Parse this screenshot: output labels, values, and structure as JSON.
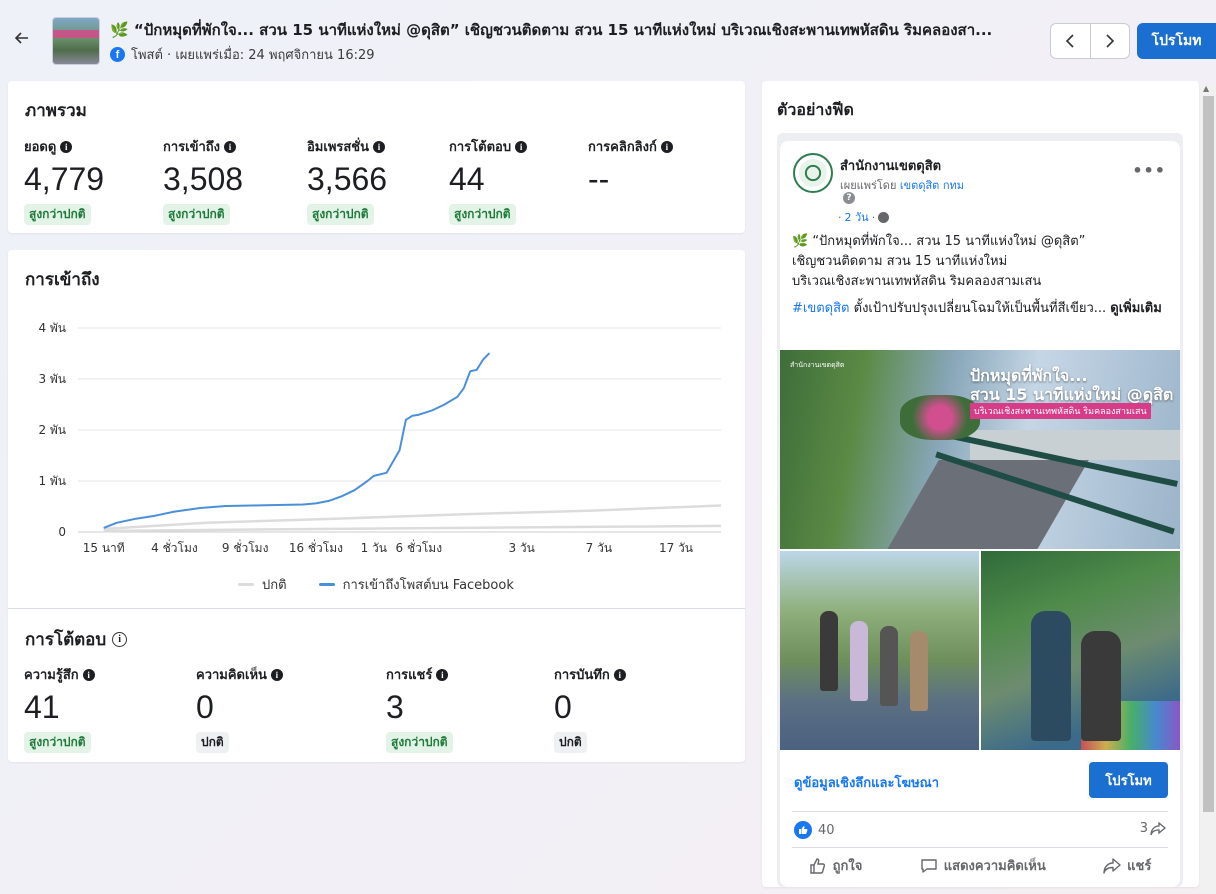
{
  "header": {
    "title": "🌿 “ปักหมุดที่พักใจ... สวน 15 นาทีแห่งใหม่ @ดุสิต” เชิญชวนติดตาม สวน 15 นาทีแห่งใหม่ บริเวณเชิงสะพานเทพหัสดิน ริมคลองสา...",
    "subtitle": "โพสต์ · เผยแพร่เมื่อ: 24 พฤศจิกายน 16:29",
    "promote_label": "โปรโมท"
  },
  "overview": {
    "title": "ภาพรวม",
    "metrics": [
      {
        "label": "ยอดดู",
        "value": "4,779",
        "badge": "สูงกว่าปกติ"
      },
      {
        "label": "การเข้าถึง",
        "value": "3,508",
        "badge": "สูงกว่าปกติ"
      },
      {
        "label": "อิมเพรสชั่น",
        "value": "3,566",
        "badge": "สูงกว่าปกติ"
      },
      {
        "label": "การโต้ตอบ",
        "value": "44",
        "badge": "สูงกว่าปกติ"
      },
      {
        "label": "การคลิกลิงก์",
        "value": "--"
      }
    ]
  },
  "reach": {
    "title": "การเข้าถึง",
    "legend_normal": "ปกติ",
    "legend_post": "การเข้าถึงโพสต์บน Facebook"
  },
  "interactions": {
    "title": "การโต้ตอบ",
    "metrics": [
      {
        "label": "ความรู้สึก",
        "value": "41",
        "badge": "สูงกว่าปกติ"
      },
      {
        "label": "ความคิดเห็น",
        "value": "0",
        "badge": "ปกติ"
      },
      {
        "label": "การแชร์",
        "value": "3",
        "badge": "สูงกว่าปกติ"
      },
      {
        "label": "การบันทึก",
        "value": "0",
        "badge": "ปกติ"
      }
    ]
  },
  "preview": {
    "title": "ตัวอย่างฟีด",
    "page_name": "สำนักงานเขตดุสิต",
    "published_prefix": "เผยแพร่โดย",
    "published_by": "เขตดุสิต กทม",
    "question_mark": "?",
    "time_prefix": "·",
    "time": "2 วัน",
    "time_suffix": "·",
    "text_line1": "🌿 “ปักหมุดที่พักใจ... สวน 15 นาทีแห่งใหม่ @ดุสิต”",
    "text_line2": "เชิญชวนติดตาม สวน 15 นาทีแห่งใหม่",
    "text_line3": "บริเวณเชิงสะพานเทพหัสดิน ริมคลองสามเสน",
    "hashtag": "#เขตดุสิต",
    "tag_text": "ตั้งเป้าปรับปรุงเปลี่ยนโฉมให้เป็นพื้นที่สีเขียว...",
    "see_more": "ดูเพิ่มเติม",
    "image_title_1": "ปักหมุดที่พักใจ...",
    "image_title_2": "สวน 15 นาทีแห่งใหม่ @ดุสิต",
    "image_band": "บริเวณเชิงสะพานเทพหัสดิน ริมคลองสามเสน",
    "image_logo": "สำนักงานเขตดุสิต",
    "cta_link": "ดูข้อมูลเชิงลึกและโฆษณา",
    "cta_button": "โปรโมท",
    "likes_count": "40",
    "shares_count": "3",
    "action_like": "ถูกใจ",
    "action_comment": "แสดงความคิดเห็น",
    "action_share": "แชร์"
  },
  "colors": {
    "accent": "#1b6fd1",
    "series_post": "#4a90d9",
    "series_normal": "#dcdcdc",
    "badge_up_bg": "#e3f3e7",
    "badge_up_text": "#1f7a3a"
  },
  "chart_data": {
    "type": "line",
    "title": "การเข้าถึง",
    "xlabel": "",
    "ylabel": "",
    "y_tick_labels": [
      "0",
      "1 พัน",
      "2 พัน",
      "3 พัน",
      "4 พัน"
    ],
    "y_tick_values": [
      0,
      1000,
      2000,
      3000,
      4000
    ],
    "ylim": [
      0,
      4000
    ],
    "x_tick_labels": [
      "15 นาที",
      "4 ชั่วโมง",
      "9 ชั่วโมง",
      "16 ชั่วโมง",
      "1 วัน",
      "6 ชั่วโมง",
      "3 วัน",
      "7 วัน",
      "17 วัน"
    ],
    "x_tick_positions": [
      0.04,
      0.15,
      0.26,
      0.37,
      0.46,
      0.53,
      0.69,
      0.81,
      0.93
    ],
    "grid": true,
    "legend_position": "bottom",
    "series": [
      {
        "name": "การเข้าถึงโพสต์บน Facebook",
        "color": "#4a90d9",
        "x": [
          0.04,
          0.06,
          0.09,
          0.12,
          0.15,
          0.19,
          0.23,
          0.27,
          0.31,
          0.35,
          0.37,
          0.39,
          0.41,
          0.43,
          0.45,
          0.46,
          0.48,
          0.5,
          0.51,
          0.52,
          0.53,
          0.55,
          0.57,
          0.59,
          0.6,
          0.61,
          0.62,
          0.63,
          0.64
        ],
        "y": [
          80,
          180,
          260,
          320,
          400,
          470,
          510,
          520,
          530,
          540,
          560,
          610,
          700,
          820,
          1000,
          1100,
          1160,
          1600,
          2200,
          2280,
          2300,
          2380,
          2500,
          2650,
          2820,
          3150,
          3180,
          3380,
          3508
        ]
      },
      {
        "name": "ปกติ",
        "color": "#dcdcdc",
        "x": [
          0.04,
          0.2,
          0.4,
          0.6,
          0.8,
          1.0
        ],
        "y": [
          60,
          180,
          260,
          350,
          420,
          520
        ]
      },
      {
        "name": "ปกติ",
        "color": "#dcdcdc",
        "x": [
          0.04,
          0.3,
          0.6,
          1.0
        ],
        "y": [
          20,
          50,
          80,
          120
        ]
      }
    ]
  }
}
